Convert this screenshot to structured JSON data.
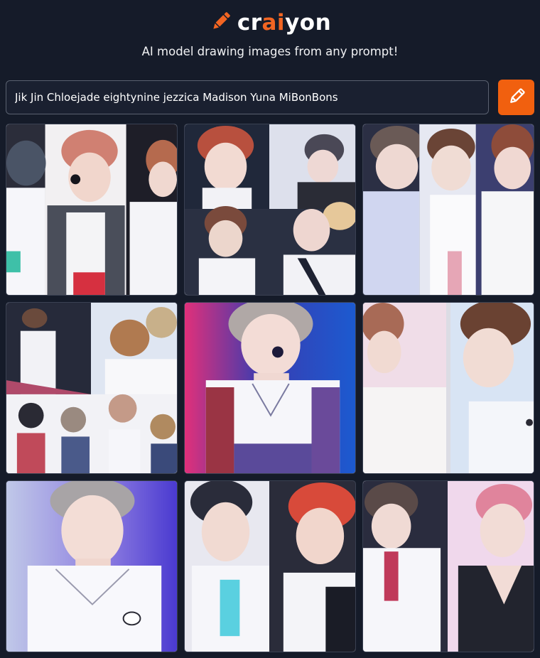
{
  "header": {
    "logo_part1": "cr",
    "logo_accent": "ai",
    "logo_part2": "yon",
    "logo_icon": "pencil-icon",
    "tagline": "AI model drawing images from any prompt!"
  },
  "prompt": {
    "value": "Jik Jin Chloejade eightynine jezzica Madison Yuna MiBonBons"
  },
  "draw_button": {
    "icon": "pencil-icon"
  },
  "colors": {
    "background": "#151b29",
    "accent": "#f26522",
    "button": "#f1600f",
    "text": "#ffffff"
  },
  "results": {
    "count": 9
  }
}
